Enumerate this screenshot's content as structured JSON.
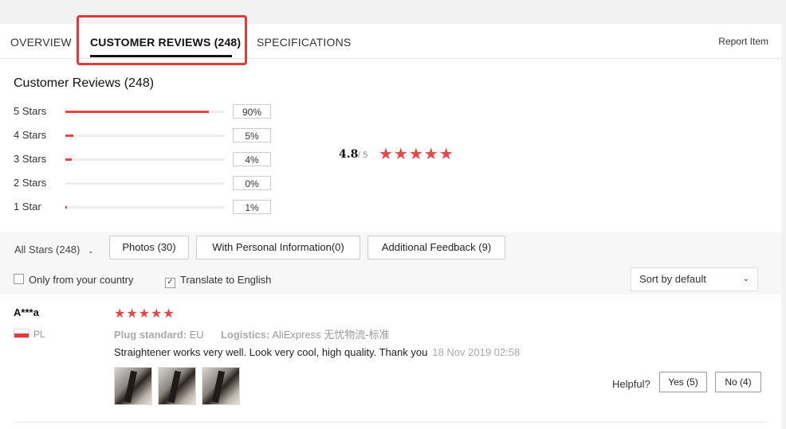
{
  "tabs": [
    {
      "label": "OVERVIEW",
      "active": false
    },
    {
      "label": "CUSTOMER REVIEWS (248)",
      "active": true
    },
    {
      "label": "SPECIFICATIONS",
      "active": false
    }
  ],
  "report_label": "Report Item",
  "section_title": "Customer Reviews (248)",
  "rating_breakdown": [
    {
      "label": "5 Stars",
      "percent_label": "90%",
      "percent": 90
    },
    {
      "label": "4 Stars",
      "percent_label": "5%",
      "percent": 5
    },
    {
      "label": "3 Stars",
      "percent_label": "4%",
      "percent": 4
    },
    {
      "label": "2 Stars",
      "percent_label": "0%",
      "percent": 0
    },
    {
      "label": "1 Star",
      "percent_label": "1%",
      "percent": 1
    }
  ],
  "average": {
    "value": "4.8",
    "max_label": "/ 5",
    "stars": "★★★★★"
  },
  "filters": {
    "stars_select": "All Stars (248)",
    "buttons": [
      "Photos (30)",
      "With Personal Information(0)",
      "Additional Feedback (9)"
    ],
    "only_country": {
      "label": "Only from your country",
      "checked": false
    },
    "translate": {
      "label": "Translate to English",
      "checked": true
    },
    "sort": "Sort by default"
  },
  "review": {
    "name": "A***a",
    "country": "PL",
    "stars": "★★★★★",
    "plug_label": "Plug standard:",
    "plug_value": "EU",
    "logistics_label": "Logistics:",
    "logistics_value": "AliExpress 无忧物流-标准",
    "text": "Straightener works very well. Look very cool, high quality. Thank you",
    "date": "18 Nov 2019 02:58",
    "helpful_label": "Helpful?",
    "yes_label": "Yes (5)",
    "no_label": "No (4)"
  },
  "colors": {
    "accent": "#e84545",
    "highlight": "#e03a3a"
  }
}
